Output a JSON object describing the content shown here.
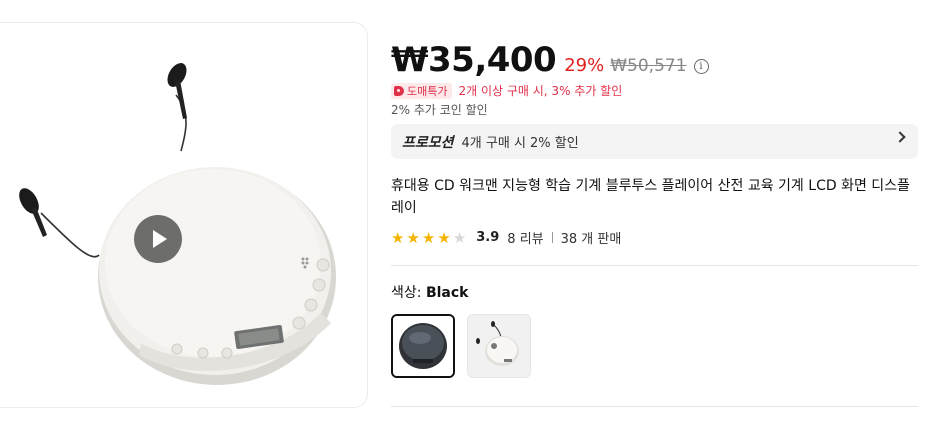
{
  "product": {
    "image_alt": "portable cd player",
    "play_icon": "play-icon"
  },
  "price": {
    "current": "₩35,400",
    "discount": "29%",
    "original": "₩50,571",
    "info_icon": "i"
  },
  "wholesale": {
    "badge": "도매특가",
    "text": "2개 이상 구매 시, 3% 추가 할인"
  },
  "coin": {
    "text": "2% 추가 코인 할인"
  },
  "promotion": {
    "label": "프로모션",
    "text": "4개 구매 시 2% 할인"
  },
  "title": "휴대용 CD 워크맨 지능형 학습 기계 블루투스 플레이어 산전 교육 기계 LCD 화면 디스플레이",
  "rating": {
    "stars_filled": 4,
    "stars_total": 5,
    "value": "3.9",
    "reviews": "8 리뷰",
    "sold": "38 개 판매"
  },
  "color": {
    "label": "색상:",
    "value": "Black",
    "options": [
      "Black",
      "White"
    ]
  },
  "colors": {
    "discount_red": "#e02020",
    "star_yellow": "#f5b400",
    "badge_bg": "#fde8ea"
  }
}
